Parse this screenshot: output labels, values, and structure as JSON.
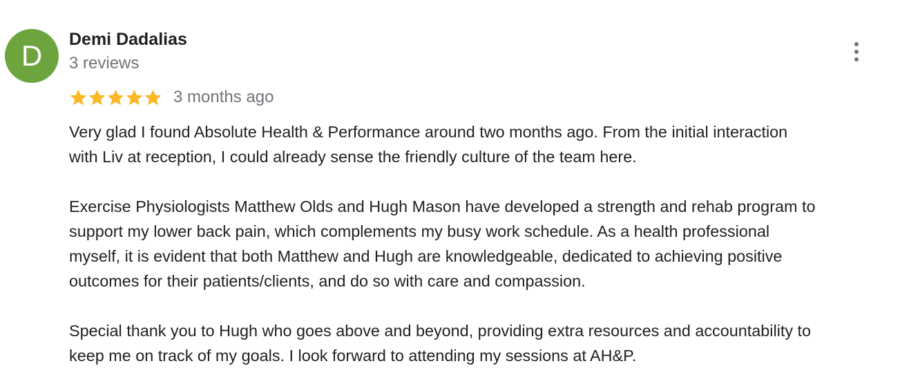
{
  "review": {
    "avatar_letter": "D",
    "avatar_color": "#6ea43e",
    "reviewer_name": "Demi Dadalias",
    "review_count": "3 reviews",
    "rating": 5,
    "rating_max": 5,
    "star_icon": "star-icon",
    "star_color": "#f9b824",
    "date": "3 months ago",
    "more_icon": "more-vert-icon",
    "paragraphs": [
      "Very glad I found Absolute Health & Performance around two months ago. From the initial interaction\nwith Liv at reception, I could already sense the friendly culture of the team here.",
      "Exercise Physiologists Matthew Olds and Hugh Mason have developed a strength and rehab program to\nsupport my lower back pain, which complements my busy work schedule. As a health professional\nmyself, it is evident that both Matthew and Hugh are knowledgeable, dedicated to achieving positive\noutcomes for their patients/clients, and do so with care and compassion.",
      "Special thank you to Hugh who goes above and beyond, providing extra resources and accountability to\nkeep me on track of my goals. I look forward to attending my sessions at AH&P."
    ]
  }
}
